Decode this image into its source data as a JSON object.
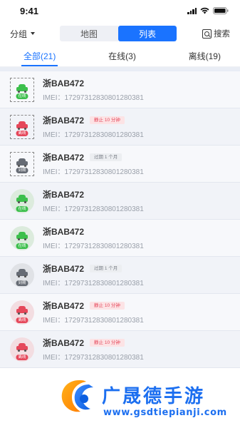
{
  "status_bar": {
    "time": "9:41"
  },
  "toolbar": {
    "group_label": "分组",
    "view_map": "地图",
    "view_list": "列表",
    "search_label": "搜索"
  },
  "tabs": [
    {
      "label": "全部(21)",
      "active": true
    },
    {
      "label": "在线(3)",
      "active": false
    },
    {
      "label": "离线(19)",
      "active": false
    }
  ],
  "vehicles": [
    {
      "plate": "浙BAB472",
      "imei": "IMEI：17297312830801280381",
      "state": "在线",
      "badge": ""
    },
    {
      "plate": "浙BAB472",
      "imei": "IMEI：17297312830801280381",
      "state": "离线",
      "badge": "静止 10 分钟"
    },
    {
      "plate": "浙BAB472",
      "imei": "IMEI：17297312830801280381",
      "state": "到期",
      "badge": "过期 1 个月"
    },
    {
      "plate": "浙BAB472",
      "imei": "IMEI：17297312830801280381",
      "state": "在线",
      "badge": ""
    },
    {
      "plate": "浙BAB472",
      "imei": "IMEI：17297312830801280381",
      "state": "在线",
      "badge": ""
    },
    {
      "plate": "浙BAB472",
      "imei": "IMEI：17297312830801280381",
      "state": "到期",
      "badge": "过期 1 个月"
    },
    {
      "plate": "浙BAB472",
      "imei": "IMEI：17297312830801280381",
      "state": "离线",
      "badge": "静止 10 分钟"
    },
    {
      "plate": "浙BAB472",
      "imei": "IMEI：17297312830801280381",
      "state": "离线",
      "badge": "静止 10 分钟"
    }
  ],
  "watermark": {
    "title": "广晟德手游",
    "url": "www.gsdtiepianji.com"
  },
  "colors": {
    "accent": "#1a73ff",
    "online": "#3cbf4c",
    "offline": "#e5475a",
    "expired": "#666b74"
  }
}
